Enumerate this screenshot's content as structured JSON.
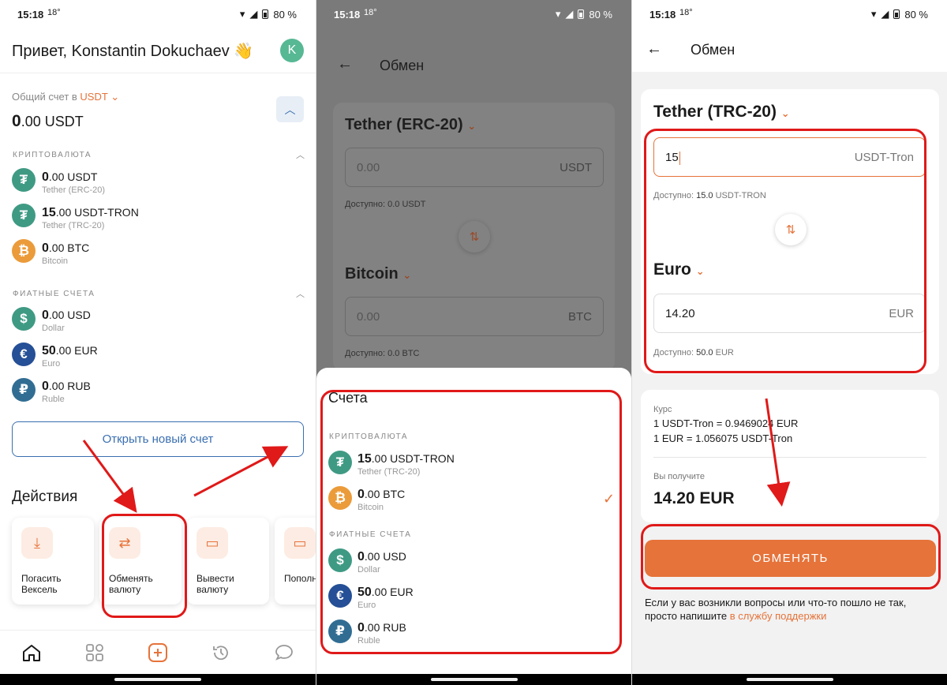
{
  "status": {
    "time": "15:18",
    "temp": "18°",
    "battery": "80 %"
  },
  "home": {
    "greeting": "Привет, Konstantin Dokuchaev 👋",
    "avatar_letter": "K",
    "total_label": "Общий счет в",
    "total_currency": "USDT",
    "total_int": "0",
    "total_dec": ".00 USDT",
    "crypto_header": "КРИПТОВАЛЮТА",
    "fiat_header": "ФИАТНЫЕ СЧЕТА",
    "crypto": [
      {
        "int": "0",
        "dec": ".00 USDT",
        "name": "Tether (ERC-20)",
        "glyph": "₮"
      },
      {
        "int": "15",
        "dec": ".00 USDT-TRON",
        "name": "Tether (TRC-20)",
        "glyph": "₮"
      },
      {
        "int": "0",
        "dec": ".00 BTC",
        "name": "Bitcoin",
        "glyph": "₿"
      }
    ],
    "fiat": [
      {
        "int": "0",
        "dec": ".00 USD",
        "name": "Dollar",
        "glyph": "$"
      },
      {
        "int": "50",
        "dec": ".00 EUR",
        "name": "Euro",
        "glyph": "€"
      },
      {
        "int": "0",
        "dec": ".00 RUB",
        "name": "Ruble",
        "glyph": "₽"
      }
    ],
    "open_account": "Открыть новый счет",
    "actions_title": "Действия",
    "actions": [
      "Погасить Вексель",
      "Обменять валюту",
      "Вывести валюту",
      "Пополн счет"
    ]
  },
  "exchange_left": {
    "title": "Обмен",
    "from_currency": "Tether (ERC-20)",
    "from_value": "0.00",
    "from_unit": "USDT",
    "from_available_label": "Доступно:",
    "from_available_value": "0.0",
    "from_available_unit": "USDT",
    "to_currency": "Bitcoin",
    "to_value": "0.00",
    "to_unit": "BTC",
    "to_available_label": "Доступно:",
    "to_available_value": "0.0",
    "to_available_unit": "BTC"
  },
  "sheet": {
    "title": "Счета",
    "crypto_header": "КРИПТОВАЛЮТА",
    "fiat_header": "ФИАТНЫЕ СЧЕТА",
    "crypto": [
      {
        "int": "15",
        "dec": ".00 USDT-TRON",
        "name": "Tether (TRC-20)",
        "glyph": "₮"
      },
      {
        "int": "0",
        "dec": ".00 BTC",
        "name": "Bitcoin",
        "glyph": "₿"
      }
    ],
    "fiat": [
      {
        "int": "0",
        "dec": ".00 USD",
        "name": "Dollar",
        "glyph": "$"
      },
      {
        "int": "50",
        "dec": ".00 EUR",
        "name": "Euro",
        "glyph": "€"
      },
      {
        "int": "0",
        "dec": ".00 RUB",
        "name": "Ruble",
        "glyph": "₽"
      }
    ],
    "checkmark": "✓"
  },
  "exchange_right": {
    "title": "Обмен",
    "from_currency": "Tether (TRC-20)",
    "from_value": "15",
    "from_unit": "USDT-Tron",
    "from_available_label": "Доступно:",
    "from_available_value": "15.0",
    "from_available_unit": "USDT-TRON",
    "to_currency": "Euro",
    "to_value": "14.20",
    "to_unit": "EUR",
    "to_available_label": "Доступно:",
    "to_available_value": "50.0",
    "to_available_unit": "EUR",
    "rate_label": "Курс",
    "rate_line1": "1 USDT-Tron = 0.9469024 EUR",
    "rate_line2": "1 EUR = 1.056075 USDT-Tron",
    "receive_label": "Вы получите",
    "receive_value": "14.20 EUR",
    "exchange_button": "ОБМЕНЯТЬ",
    "help_text": "Если у вас возникли вопросы или что-то пошло не так, просто напишите",
    "help_link": "в службу поддержки"
  },
  "colors": {
    "accent": "#e6733a",
    "annotation": "#e01919",
    "link": "#2e6fb8"
  }
}
